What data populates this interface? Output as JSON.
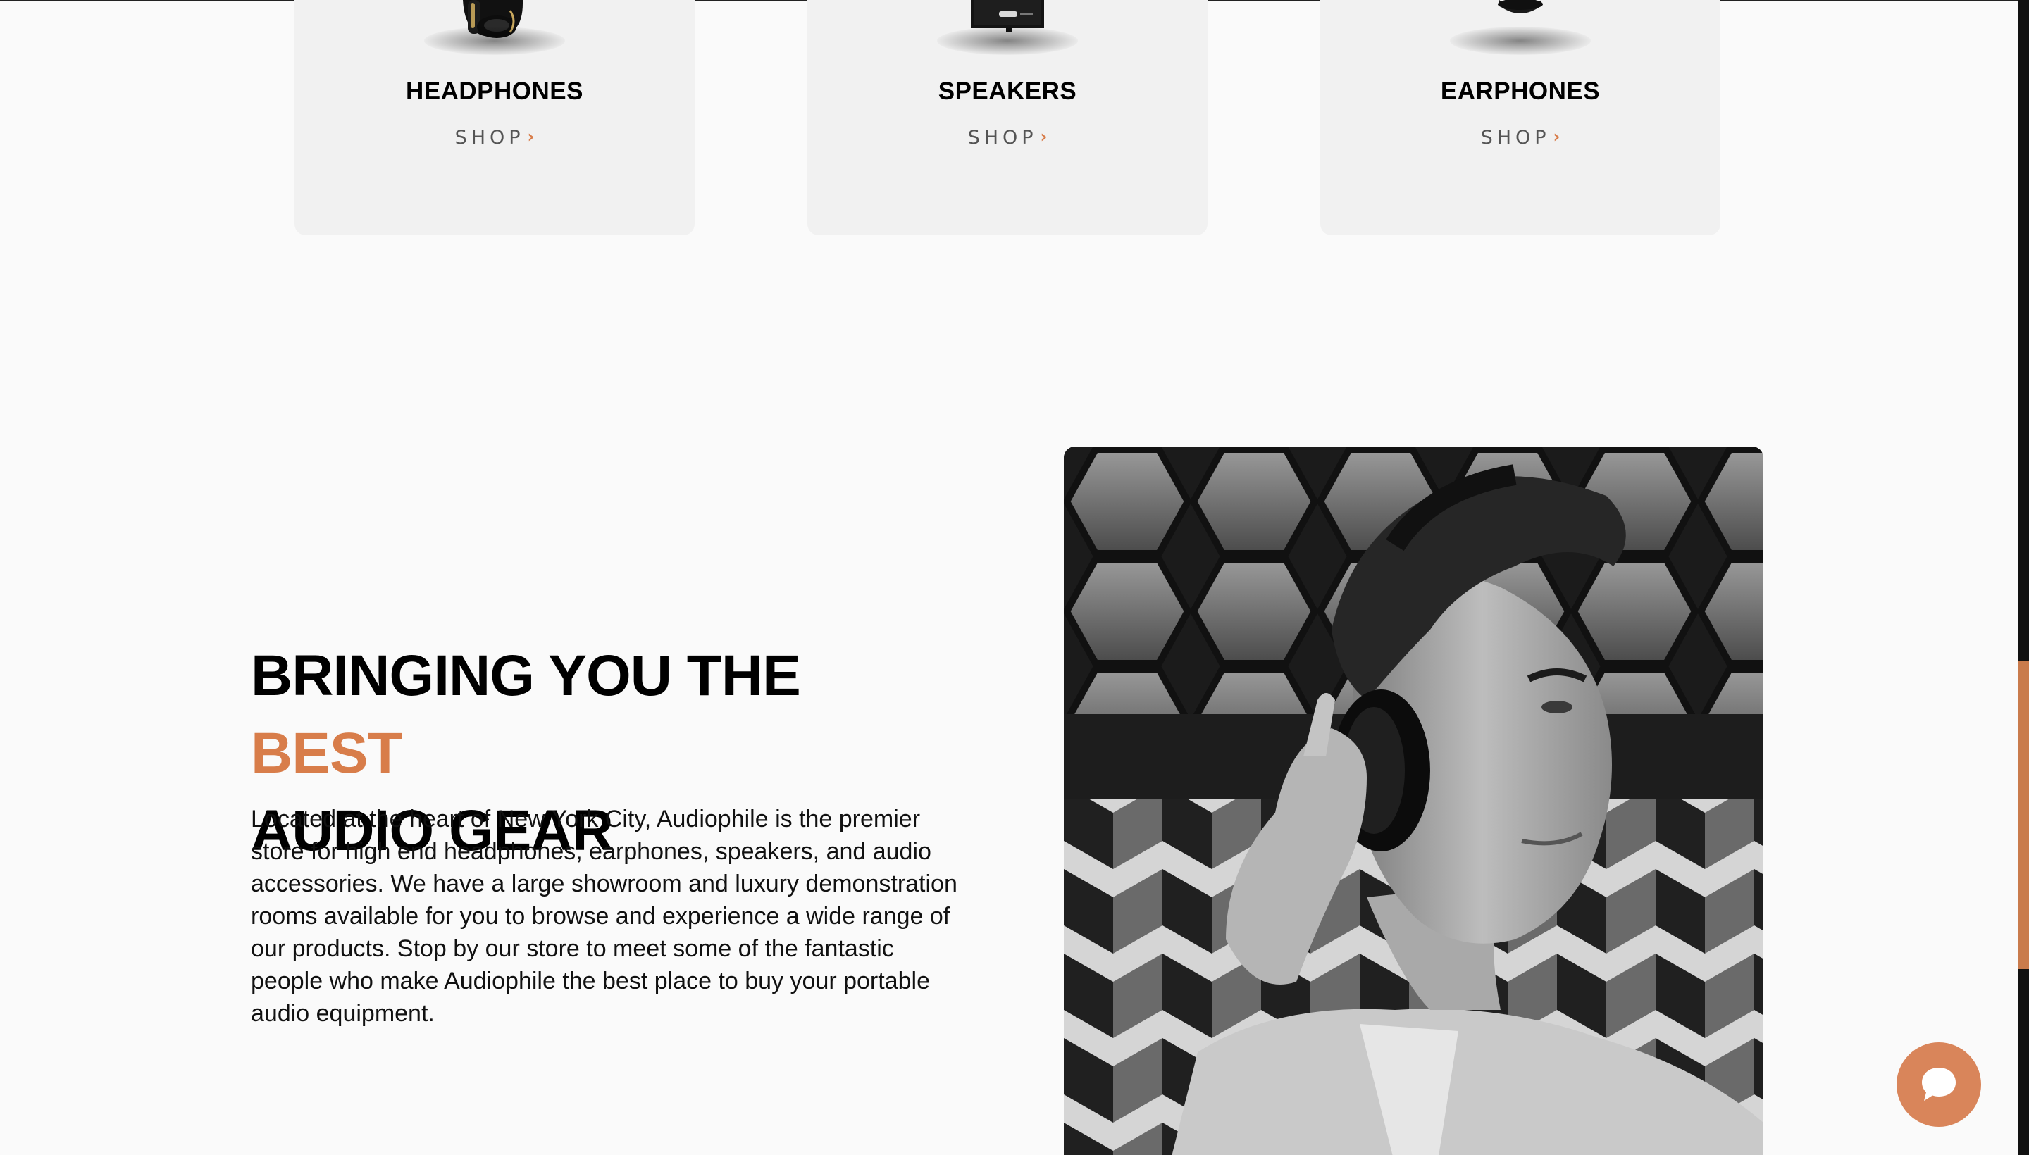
{
  "categories": [
    {
      "title": "HEADPHONES",
      "link_label": "SHOP",
      "chevron": "›",
      "icon": "headphones-icon"
    },
    {
      "title": "SPEAKERS",
      "link_label": "SHOP",
      "chevron": "›",
      "icon": "speaker-icon"
    },
    {
      "title": "EARPHONES",
      "link_label": "SHOP",
      "chevron": "›",
      "icon": "earphones-icon"
    }
  ],
  "about": {
    "title_part1": "BRINGING YOU THE ",
    "title_accent": "BEST",
    "title_part2": "AUDIO GEAR",
    "body": "Located at the heart of New York City, Audiophile is the premier store for high end headphones, earphones, speakers, and audio accessories. We have a large showroom and luxury demonstration rooms available for you to browse and experience a wide range of our products. Stop by our store to meet some of the fantastic people who make Audiophile the best place to buy your portable audio equipment."
  },
  "chat": {
    "icon": "chat-bubble-icon"
  },
  "colors": {
    "accent": "#d87d4a",
    "background": "#fafafa",
    "card": "#f1f1f1",
    "text": "#000000",
    "chat_button": "#d9855a",
    "scrollbar_thumb": "#c97b4c"
  }
}
